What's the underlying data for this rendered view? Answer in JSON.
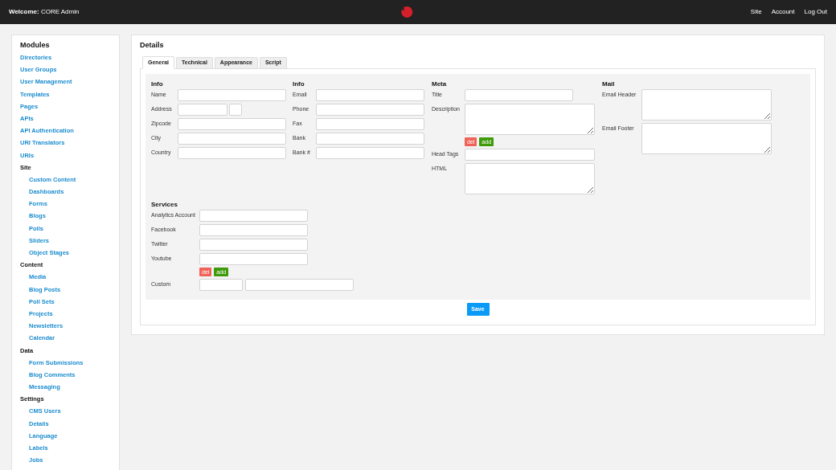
{
  "header": {
    "welcome_label": "Welcome:",
    "user_name": "CORE Admin",
    "nav": [
      "Site",
      "Account",
      "Log Out"
    ]
  },
  "sidebar": {
    "title": "Modules",
    "items": [
      {
        "label": "Directories",
        "kind": "link"
      },
      {
        "label": "User Groups",
        "kind": "link"
      },
      {
        "label": "User Management",
        "kind": "link"
      },
      {
        "label": "Templates",
        "kind": "link"
      },
      {
        "label": "Pages",
        "kind": "link"
      },
      {
        "label": "APIs",
        "kind": "link"
      },
      {
        "label": "API Authentication",
        "kind": "link"
      },
      {
        "label": "URI Translators",
        "kind": "link"
      },
      {
        "label": "URIs",
        "kind": "link"
      },
      {
        "label": "Site",
        "kind": "heading",
        "children": [
          {
            "label": "Custom Content"
          },
          {
            "label": "Dashboards"
          },
          {
            "label": "Forms"
          },
          {
            "label": "Blogs"
          },
          {
            "label": "Polls"
          },
          {
            "label": "Sliders"
          },
          {
            "label": "Object Stages"
          }
        ]
      },
      {
        "label": "Content",
        "kind": "heading",
        "children": [
          {
            "label": "Media"
          },
          {
            "label": "Blog Posts"
          },
          {
            "label": "Poll Sets"
          },
          {
            "label": "Projects"
          },
          {
            "label": "Newsletters"
          },
          {
            "label": "Calendar"
          }
        ]
      },
      {
        "label": "Data",
        "kind": "heading",
        "children": [
          {
            "label": "Form Submissions"
          },
          {
            "label": "Blog Comments"
          },
          {
            "label": "Messaging"
          }
        ]
      },
      {
        "label": "Settings",
        "kind": "heading",
        "children": [
          {
            "label": "CMS Users"
          },
          {
            "label": "Details"
          },
          {
            "label": "Language"
          },
          {
            "label": "Labels"
          },
          {
            "label": "Jobs"
          }
        ]
      }
    ]
  },
  "details": {
    "title": "Details",
    "tabs": [
      {
        "label": "General",
        "selected": true
      },
      {
        "label": "Technical",
        "selected": false
      },
      {
        "label": "Appearance",
        "selected": false
      },
      {
        "label": "Script",
        "selected": false
      }
    ],
    "columns": [
      {
        "title": "Info",
        "fields": [
          {
            "label": "Name",
            "kind": "text"
          },
          {
            "label": "Address",
            "kind": "address"
          },
          {
            "label": "Zipcode",
            "kind": "text"
          },
          {
            "label": "City",
            "kind": "text"
          },
          {
            "label": "Country",
            "kind": "text"
          }
        ]
      },
      {
        "title": "Info",
        "fields": [
          {
            "label": "Email",
            "kind": "text"
          },
          {
            "label": "Phone",
            "kind": "text"
          },
          {
            "label": "Fax",
            "kind": "text"
          },
          {
            "label": "Bank",
            "kind": "text"
          },
          {
            "label": "Bank #",
            "kind": "text"
          }
        ]
      },
      {
        "title": "Meta",
        "fields": [
          {
            "label": "Title",
            "kind": "text"
          },
          {
            "label": "Description",
            "kind": "textarea"
          },
          {
            "kind": "actions",
            "buttons": [
              "del",
              "add"
            ]
          },
          {
            "label": "Head Tags",
            "kind": "wide"
          },
          {
            "label": "HTML",
            "kind": "textarea"
          }
        ]
      },
      {
        "title": "Mail",
        "fields": [
          {
            "label": "Email Header",
            "kind": "textarea"
          },
          {
            "label": "Email Footer",
            "kind": "textarea"
          }
        ]
      }
    ],
    "services": {
      "title": "Services",
      "fields": [
        {
          "label": "Analytics Account",
          "kind": "text"
        },
        {
          "label": "Facebook",
          "kind": "text"
        },
        {
          "label": "Twitter",
          "kind": "text"
        },
        {
          "label": "Youtube",
          "kind": "text"
        },
        {
          "kind": "actions",
          "buttons": [
            "del",
            "add"
          ]
        },
        {
          "label": "Custom",
          "kind": "custom"
        }
      ]
    },
    "save_button": "Save"
  }
}
